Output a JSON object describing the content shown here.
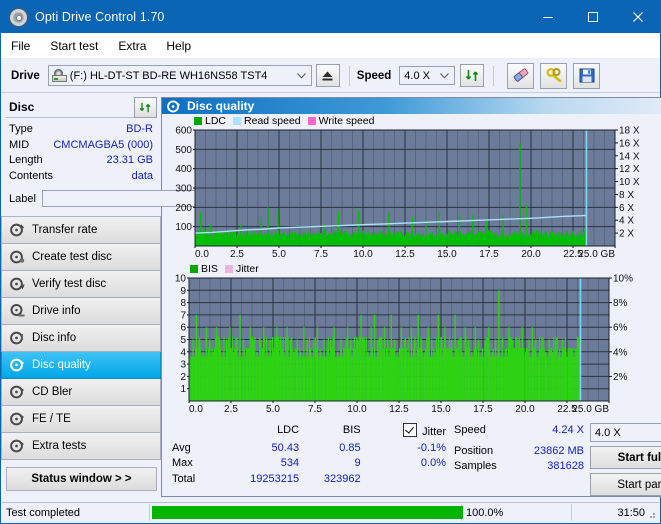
{
  "window": {
    "title": "Opti Drive Control 1.70",
    "icon": "disc-icon",
    "minimize": "minimize-icon",
    "maximize": "maximize-icon",
    "close": "close-icon"
  },
  "menu": {
    "items": [
      {
        "label": "File"
      },
      {
        "label": "Start test"
      },
      {
        "label": "Extra"
      },
      {
        "label": "Help"
      }
    ]
  },
  "toolbar": {
    "drive_label": "Drive",
    "drive_value": "(F:)  HL-DT-ST BD-RE  WH16NS58 TST4",
    "eject_icon": "eject-icon",
    "speed_label": "Speed",
    "speed_value": "4.0 X",
    "refresh_icon": "refresh-icon",
    "erase_icon": "eraser-icon",
    "settings_icon": "wrench-key-icon",
    "save_icon": "floppy-save-icon"
  },
  "disc": {
    "header": "Disc",
    "refresh_icon": "refresh-icon",
    "rows": [
      {
        "key": "Type",
        "value": "BD-R"
      },
      {
        "key": "MID",
        "value": "CMCMAGBA5 (000)"
      },
      {
        "key": "Length",
        "value": "23.31 GB"
      },
      {
        "key": "Contents",
        "value": "data"
      }
    ],
    "label_key": "Label",
    "label_value": "",
    "label_placeholder": "",
    "label_button_icon": "disc-icon"
  },
  "sidebar": {
    "items": [
      {
        "label": "Transfer rate",
        "icon": "disc-test-icon",
        "selected": false
      },
      {
        "label": "Create test disc",
        "icon": "disc-write-icon",
        "selected": false
      },
      {
        "label": "Verify test disc",
        "icon": "disc-verify-icon",
        "selected": false
      },
      {
        "label": "Drive info",
        "icon": "drive-info-icon",
        "selected": false
      },
      {
        "label": "Disc info",
        "icon": "disc-info-icon",
        "selected": false
      },
      {
        "label": "Disc quality",
        "icon": "disc-quality-icon",
        "selected": true
      },
      {
        "label": "CD Bler",
        "icon": "cd-bler-icon",
        "selected": false
      },
      {
        "label": "FE / TE",
        "icon": "fe-te-icon",
        "selected": false
      },
      {
        "label": "Extra tests",
        "icon": "extra-tests-icon",
        "selected": false
      }
    ],
    "status_window": "Status window > >"
  },
  "panel": {
    "title": "Disc quality",
    "icon": "disc-quality-icon"
  },
  "stats": {
    "columns": [
      "",
      "LDC",
      "BIS",
      "Jitter"
    ],
    "jitter_checked": true,
    "jitter_label": "Jitter",
    "rows": [
      {
        "label": "Avg",
        "ldc": "50.43",
        "bis": "0.85",
        "jitter": "-0.1%"
      },
      {
        "label": "Max",
        "ldc": "534",
        "bis": "9",
        "jitter": "0.0%"
      },
      {
        "label": "Total",
        "ldc": "19253215",
        "bis": "323962",
        "jitter": ""
      }
    ]
  },
  "readout": {
    "speed_key": "Speed",
    "speed_value": "4.24 X",
    "position_key": "Position",
    "position_value": "23862 MB",
    "samples_key": "Samples",
    "samples_value": "381628",
    "speed_select": "4.0 X",
    "start_full": "Start full",
    "start_part": "Start part"
  },
  "statusbar": {
    "message": "Test completed",
    "progress_pct": "100.0%",
    "progress_value": 100,
    "elapsed": "31:50"
  },
  "colors": {
    "accent": "#0a64b4",
    "ldc_green": "#00c000",
    "bis_green": "#2cd412",
    "read_speed": "#a8e2fb",
    "write_speed": "#ff66cc",
    "jitter_pink": "#e8b4e0",
    "plot_bg": "#6c7b99",
    "value_blue": "#1422b4",
    "selected": "#00a6e8"
  },
  "chart_data": [
    {
      "type": "area",
      "name": "quality-top-chart",
      "title": "",
      "xlabel": "GB",
      "ylabel": "LDC",
      "xlim": [
        0.0,
        25.0
      ],
      "xticks": [
        "0.0",
        "2.5",
        "5.0",
        "7.5",
        "10.0",
        "12.5",
        "15.0",
        "17.5",
        "20.0",
        "22.5",
        "25.0 GB"
      ],
      "ylim": [
        0,
        600
      ],
      "yticks": [
        "100",
        "200",
        "300",
        "400",
        "500",
        "600"
      ],
      "y2lim": [
        0,
        18
      ],
      "y2ticks": [
        "2 X",
        "4 X",
        "6 X",
        "8 X",
        "10 X",
        "12 X",
        "14 X",
        "16 X",
        "18 X"
      ],
      "grid": true,
      "legend": [
        "LDC",
        "Read speed",
        "Write speed"
      ],
      "legend_colors": [
        "#00a800",
        "#a8e2fb",
        "#ff66cc"
      ],
      "legend_position": "top-left",
      "data_end_gb": 23.3,
      "series": [
        {
          "name": "LDC",
          "color": "#00c000",
          "kind": "column",
          "x": [
            0.1,
            0.3,
            0.5,
            0.7,
            0.9,
            1.1,
            1.3,
            1.5,
            1.7,
            1.9,
            2.1,
            2.3,
            2.5,
            2.7,
            2.9,
            3.1,
            3.3,
            3.5,
            3.7,
            3.9,
            4.1,
            4.3,
            4.5,
            4.7,
            4.9,
            5.1,
            5.3,
            5.5,
            5.7,
            5.9,
            6.1,
            6.3,
            6.5,
            6.7,
            6.9,
            7.1,
            7.3,
            7.5,
            7.7,
            7.9,
            8.1,
            8.3,
            8.5,
            8.7,
            8.9,
            9.1,
            9.3,
            9.5,
            9.7,
            9.9,
            10.1,
            10.3,
            10.5,
            10.7,
            10.9,
            11.1,
            11.3,
            11.5,
            11.7,
            11.9,
            12.1,
            12.3,
            12.5,
            12.7,
            12.9,
            13.1,
            13.3,
            13.5,
            13.7,
            13.9,
            14.1,
            14.3,
            14.5,
            14.7,
            14.9,
            15.1,
            15.3,
            15.5,
            15.7,
            15.9,
            16.1,
            16.3,
            16.5,
            16.7,
            16.9,
            17.1,
            17.3,
            17.5,
            17.7,
            17.9,
            18.1,
            18.3,
            18.5,
            18.7,
            18.9,
            19.1,
            19.3,
            19.5,
            19.7,
            19.9,
            20.1,
            20.3,
            20.5,
            20.7,
            20.9,
            21.1,
            21.3,
            21.5,
            21.7,
            21.9,
            22.1,
            22.3,
            22.5,
            22.7,
            22.9,
            23.1,
            23.3
          ],
          "values": [
            60,
            175,
            95,
            70,
            115,
            65,
            60,
            70,
            62,
            60,
            58,
            65,
            60,
            110,
            58,
            62,
            90,
            60,
            58,
            150,
            60,
            200,
            64,
            58,
            185,
            60,
            60,
            62,
            58,
            72,
            60,
            64,
            58,
            66,
            60,
            58,
            62,
            60,
            110,
            60,
            58,
            62,
            175,
            58,
            60,
            62,
            58,
            60,
            185,
            60,
            62,
            58,
            60,
            64,
            58,
            60,
            62,
            175,
            60,
            58,
            62,
            60,
            58,
            60,
            150,
            62,
            58,
            60,
            130,
            58,
            62,
            60,
            175,
            60,
            58,
            62,
            60,
            58,
            160,
            60,
            62,
            58,
            160,
            60,
            58,
            62,
            140,
            60,
            58,
            62,
            60,
            160,
            58,
            60,
            62,
            58,
            534,
            60,
            210,
            58,
            62,
            60,
            58,
            62,
            60,
            58,
            62,
            60,
            58,
            62,
            58,
            60,
            62
          ],
          "baseline_avg": 50.43,
          "max": 534,
          "total": 19253215
        },
        {
          "name": "Read speed",
          "color": "#a8e2fb",
          "kind": "line",
          "axis": "right",
          "x": [
            0.0,
            1.0,
            2.0,
            3.0,
            4.0,
            5.0,
            6.0,
            7.0,
            8.0,
            9.0,
            10.0,
            11.0,
            12.0,
            13.0,
            14.0,
            15.0,
            16.0,
            17.0,
            18.0,
            19.0,
            20.0,
            21.0,
            22.0,
            23.0,
            23.3
          ],
          "values": [
            2.0,
            2.1,
            2.3,
            2.5,
            2.6,
            2.8,
            2.9,
            3.0,
            3.1,
            3.2,
            3.3,
            3.4,
            3.5,
            3.6,
            3.7,
            3.8,
            3.9,
            4.0,
            4.1,
            4.2,
            4.3,
            4.45,
            4.6,
            4.7,
            4.75
          ]
        },
        {
          "name": "Write speed",
          "color": "#ff66cc",
          "kind": "line",
          "x": [],
          "values": []
        }
      ]
    },
    {
      "type": "bar",
      "name": "quality-bottom-chart",
      "title": "",
      "xlabel": "GB",
      "ylabel": "BIS",
      "xlim": [
        0.0,
        25.0
      ],
      "xticks": [
        "0.0",
        "2.5",
        "5.0",
        "7.5",
        "10.0",
        "12.5",
        "15.0",
        "17.5",
        "20.0",
        "22.5",
        "25.0 GB"
      ],
      "ylim": [
        0,
        10
      ],
      "yticks": [
        "1",
        "2",
        "3",
        "4",
        "5",
        "6",
        "7",
        "8",
        "9",
        "10"
      ],
      "y2lim": [
        0,
        10
      ],
      "y2ticks": [
        "2%",
        "4%",
        "6%",
        "8%",
        "10%"
      ],
      "grid": true,
      "legend": [
        "BIS",
        "Jitter"
      ],
      "legend_colors": [
        "#00a800",
        "#e8b4e0"
      ],
      "legend_position": "top-left",
      "data_end_gb": 23.3,
      "series": [
        {
          "name": "BIS",
          "color": "#2cd412",
          "kind": "column",
          "baseline_avg": 0.85,
          "max": 9,
          "total": 323962,
          "x": [
            0.2,
            0.4,
            0.6,
            0.8,
            1.0,
            1.2,
            1.4,
            1.6,
            1.8,
            2.0,
            2.2,
            2.4,
            2.6,
            2.8,
            3.0,
            3.2,
            3.4,
            3.6,
            3.8,
            4.0,
            4.2,
            4.4,
            4.6,
            4.8,
            5.0,
            5.2,
            5.4,
            5.6,
            5.8,
            6.0,
            6.2,
            6.4,
            6.6,
            6.8,
            7.0,
            7.2,
            7.4,
            7.6,
            7.8,
            8.0,
            8.2,
            8.4,
            8.6,
            8.8,
            9.0,
            9.2,
            9.4,
            9.6,
            9.8,
            10.0,
            10.2,
            10.4,
            10.6,
            10.8,
            11.0,
            11.2,
            11.4,
            11.6,
            11.8,
            12.0,
            12.2,
            12.4,
            12.6,
            12.8,
            13.0,
            13.2,
            13.4,
            13.6,
            13.8,
            14.0,
            14.2,
            14.4,
            14.6,
            14.8,
            15.0,
            15.2,
            15.4,
            15.6,
            15.8,
            16.0,
            16.2,
            16.4,
            16.6,
            16.8,
            17.0,
            17.2,
            17.4,
            17.6,
            17.8,
            18.0,
            18.2,
            18.4,
            18.6,
            18.8,
            19.0,
            19.2,
            19.4,
            19.6,
            19.8,
            20.0,
            20.2,
            20.4,
            20.6,
            20.8,
            21.0,
            21.2,
            21.4,
            21.6,
            21.8,
            22.0,
            22.2,
            22.4,
            22.6,
            22.8,
            23.0,
            23.2,
            23.3
          ],
          "values": [
            5,
            7,
            5,
            4,
            6,
            5,
            4,
            6,
            5,
            4,
            5,
            6,
            4,
            5,
            7,
            5,
            4,
            6,
            5,
            4,
            5,
            6,
            4,
            5,
            4,
            6,
            5,
            4,
            6,
            5,
            4,
            5,
            4,
            6,
            5,
            4,
            5,
            6,
            4,
            5,
            4,
            5,
            6,
            4,
            5,
            4,
            6,
            5,
            4,
            5,
            7,
            5,
            4,
            6,
            7,
            5,
            4,
            6,
            5,
            7,
            5,
            4,
            6,
            5,
            4,
            6,
            5,
            7,
            5,
            4,
            6,
            5,
            4,
            7,
            5,
            6,
            4,
            5,
            7,
            5,
            4,
            6,
            5,
            4,
            6,
            5,
            4,
            5,
            6,
            4,
            5,
            9,
            5,
            4,
            6,
            5,
            4,
            5,
            6,
            4,
            5,
            6,
            5,
            4,
            5,
            4,
            5,
            4,
            5,
            4,
            5,
            4,
            4
          ]
        },
        {
          "name": "Jitter",
          "color": "#e8b4e0",
          "kind": "line",
          "x": [],
          "values": []
        }
      ]
    }
  ]
}
